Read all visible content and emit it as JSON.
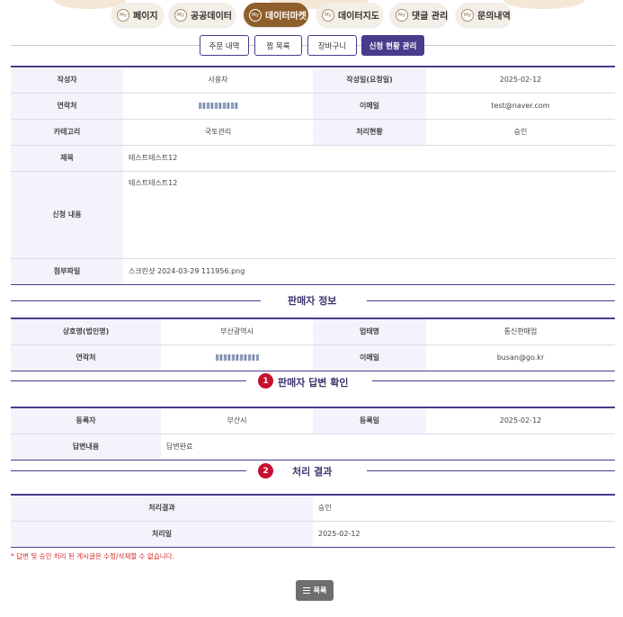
{
  "nav": {
    "my_badge": "My",
    "tabs": [
      {
        "label": "페이지"
      },
      {
        "label": "공공데이터"
      },
      {
        "label": "데이터마켓"
      },
      {
        "label": "데이터지도"
      },
      {
        "label": "댓글 관리"
      },
      {
        "label": "문의내역"
      }
    ],
    "active_index": 2
  },
  "subtabs": [
    {
      "label": "주문 내역"
    },
    {
      "label": "찜 목록"
    },
    {
      "label": "장바구니"
    },
    {
      "label": "신청 현황 관리"
    }
  ],
  "request": {
    "author_label": "작성자",
    "author": "사용자",
    "date_label": "작성일(요청일)",
    "date": "2025-02-12",
    "contact_label": "연락처",
    "email_label": "이메일",
    "email": "test@naver.com",
    "category_label": "카테고리",
    "category": "국토관리",
    "status_label": "처리현황",
    "status": "승인",
    "subject_label": "제목",
    "subject": "테스트테스트12",
    "content_label": "신청 내용",
    "content": "테스트테스트12",
    "attach_label": "첨부파일",
    "attach": "스크린샷 2024-03-29 111956.png"
  },
  "seller": {
    "section_title": "판매자 정보",
    "company_label": "상호명(법인명)",
    "company": "부산광역시",
    "biz_label": "업태명",
    "biz": "통신판매업",
    "contact_label": "연락처",
    "email_label": "이메일",
    "email": "busan@go.kr"
  },
  "reply": {
    "badge": "1",
    "section_title": "판매자 답변 확인",
    "registrant_label": "등록자",
    "registrant": "부산시",
    "reg_date_label": "등록일",
    "reg_date": "2025-02-12",
    "content_label": "답변내용",
    "content": "답변완료"
  },
  "result": {
    "badge": "2",
    "section_title": "처리 결과",
    "result_label": "처리결과",
    "result": "승인",
    "date_label": "처리일",
    "date": "2025-02-12"
  },
  "notice": "* 답변 및 승인 처리 된 게시글은 수정/삭제할 수 없습니다.",
  "list_button": "목록",
  "colors": {
    "primary": "#4a3c8c",
    "active_tab": "#8e5e2b",
    "header_cell": "#f4f3fb",
    "badge": "#c8102e",
    "notice": "#d62b2b",
    "list_button": "#6e6e6e"
  }
}
